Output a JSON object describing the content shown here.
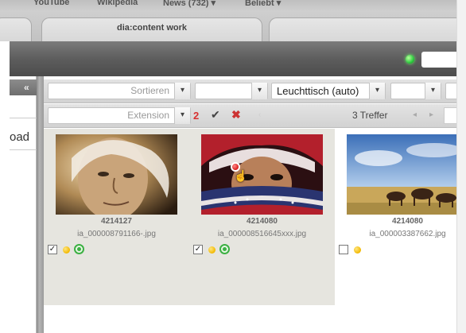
{
  "browser": {
    "bookmarks": [
      "YouTube",
      "Wikipedia",
      "News (732) ▾",
      "Beliebt ▾"
    ],
    "tab_title": "dia:content work"
  },
  "app": {
    "status_color": "#2ecc40"
  },
  "left_panel": {
    "collapse_label": "«",
    "partial_label": "oad"
  },
  "filters": {
    "sort_placeholder": "Sortieren",
    "view_mode": "Leuchttisch (auto)",
    "extension_placeholder": "Extension",
    "selected_count": "2",
    "hits": "3 Treffer"
  },
  "assets": [
    {
      "id": "4214127",
      "filename": "ia_000008791166-.jpg",
      "checked": "✓",
      "selected": true,
      "status": [
        "yellow",
        "green"
      ]
    },
    {
      "id": "4214080",
      "filename": "ia_000008516645xxx.jpg",
      "checked": "✓",
      "selected": true,
      "status": [
        "yellow",
        "green"
      ]
    },
    {
      "id": "4214080",
      "filename": "ia_000003387662.jpg",
      "checked": "",
      "selected": false,
      "status": [
        "yellow"
      ]
    }
  ]
}
